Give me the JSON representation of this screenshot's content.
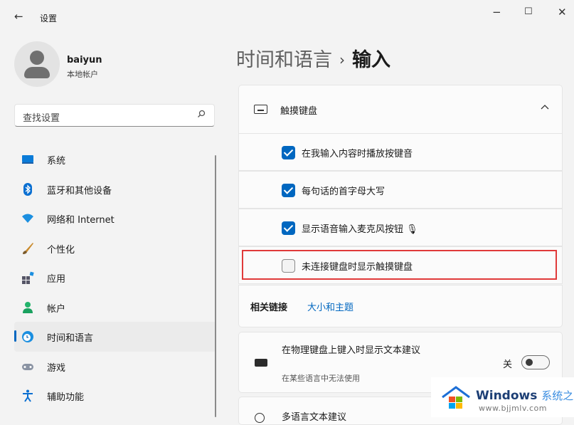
{
  "window": {
    "back_glyph": "←",
    "title": "设置",
    "minimize": "−",
    "maximize": "☐",
    "close": "✕"
  },
  "profile": {
    "name": "baiyun",
    "account_type": "本地帐户"
  },
  "search": {
    "placeholder": "查找设置",
    "icon_glyph": "⚲"
  },
  "sidebar": {
    "items": [
      {
        "label": "系统",
        "icon": "system-icon"
      },
      {
        "label": "蓝牙和其他设备",
        "icon": "bluetooth-icon"
      },
      {
        "label": "网络和 Internet",
        "icon": "wifi-icon"
      },
      {
        "label": "个性化",
        "icon": "brush-icon"
      },
      {
        "label": "应用",
        "icon": "apps-icon"
      },
      {
        "label": "帐户",
        "icon": "account-icon"
      },
      {
        "label": "时间和语言",
        "icon": "time-language-icon",
        "active": true
      },
      {
        "label": "游戏",
        "icon": "gaming-icon"
      },
      {
        "label": "辅助功能",
        "icon": "accessibility-icon"
      }
    ]
  },
  "breadcrumb": {
    "parent": "时间和语言",
    "separator": "›",
    "current": "输入"
  },
  "touch_keyboard": {
    "title": "触摸键盘",
    "expand_glyph": "⌃",
    "options": [
      {
        "label": "在我输入内容时播放按键音",
        "checked": true
      },
      {
        "label": "每句话的首字母大写",
        "checked": true
      },
      {
        "label": "显示语音输入麦克风按钮 🎙",
        "checked": true
      },
      {
        "label": "未连接键盘时显示触摸键盘",
        "checked": false
      }
    ],
    "related_label": "相关链接",
    "related_link": "大小和主题"
  },
  "hardware_suggestions": {
    "title": "在物理键盘上键入时显示文本建议",
    "subtitle": "在某些语言中无法使用",
    "state_label": "关",
    "enabled": false
  },
  "multilingual": {
    "title": "多语言文本建议"
  },
  "watermark": {
    "brand": "Windows",
    "brand_suffix": "系统之家",
    "url": "www.bjjmlv.com"
  },
  "colors": {
    "accent": "#0067c0",
    "highlight_box": "#e03a3a"
  }
}
